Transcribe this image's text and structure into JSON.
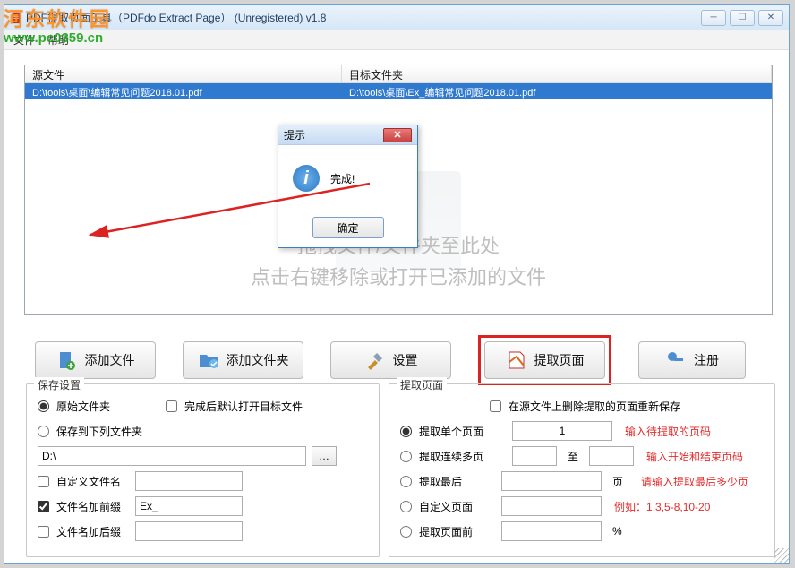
{
  "window": {
    "title": "PDF提取页面工具（PDFdo Extract Page） (Unregistered) v1.8"
  },
  "menu": {
    "file": "文件",
    "help": "帮助"
  },
  "watermark": {
    "brand": "河东软件园",
    "site": "www.pc0359.cn"
  },
  "list": {
    "col_source": "源文件",
    "col_target": "目标文件夹",
    "rows": [
      {
        "src": "D:\\tools\\桌面\\编辑常见问题2018.01.pdf",
        "dst": "D:\\tools\\桌面\\Ex_编辑常见问题2018.01.pdf"
      }
    ],
    "hint_line1": "拖拽文件/文件夹至此处",
    "hint_line2": "点击右键移除或打开已添加的文件"
  },
  "dialog": {
    "title": "提示",
    "message": "完成!",
    "ok": "确定"
  },
  "toolbar": {
    "add_file": "添加文件",
    "add_folder": "添加文件夹",
    "settings": "设置",
    "extract": "提取页面",
    "register": "注册"
  },
  "save": {
    "legend": "保存设置",
    "original_folder": "原始文件夹",
    "save_to_folder": "保存到下列文件夹",
    "path": "D:\\",
    "custom_name": "自定义文件名",
    "prefix": "文件名加前缀",
    "prefix_value": "Ex_",
    "suffix": "文件名加后缀",
    "open_after": "完成后默认打开目标文件"
  },
  "extract": {
    "legend": "提取页面",
    "delete_from_source": "在源文件上删除提取的页面重新保存",
    "single": "提取单个页面",
    "single_val": "1",
    "single_hint": "输入待提取的页码",
    "range": "提取连续多页",
    "range_to": "至",
    "range_hint": "输入开始和结束页码",
    "last": "提取最后",
    "last_unit": "页",
    "last_hint": "请输入提取最后多少页",
    "custom": "自定义页面",
    "custom_hint": "例如：1,3,5-8,10-20",
    "before": "提取页面前",
    "before_unit": "%"
  }
}
